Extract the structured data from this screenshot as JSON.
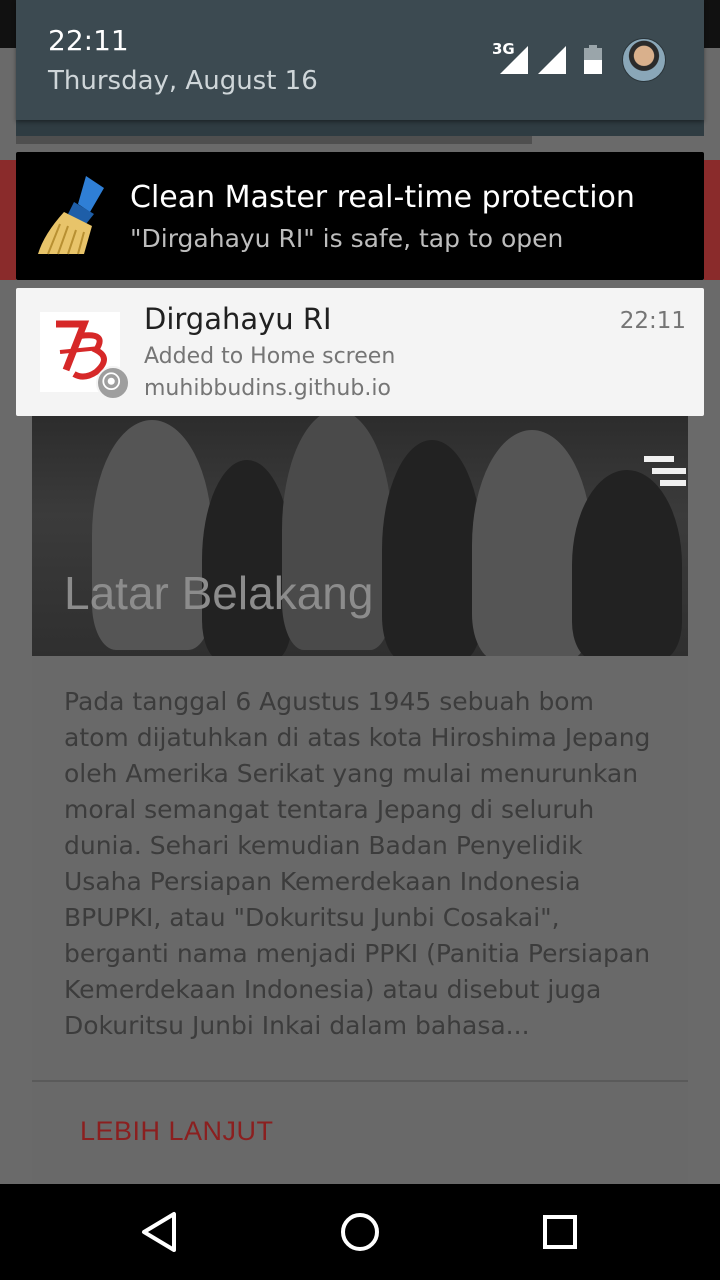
{
  "status": {
    "time": "22:11",
    "date": "Thursday, August 16",
    "network": "3G"
  },
  "notifications": [
    {
      "app": "Clean Master",
      "title": "Clean Master real-time protection",
      "text": "\"Dirgahayu RI\" is safe, tap to open"
    },
    {
      "title": "Dirgahayu RI",
      "time": "22:11",
      "line2": "Added to Home screen",
      "line3": "muhibbudins.github.io",
      "badge": "chrome-icon"
    }
  ],
  "page": {
    "hero_title": "Latar Belakang",
    "body": "Pada tanggal 6 Agustus 1945 sebuah bom atom dijatuhkan di atas kota Hiroshima Jepang oleh Amerika Serikat yang mulai menurunkan moral semangat tentara Jepang di seluruh dunia. Sehari kemudian Badan Penyelidik Usaha Persiapan Kemerdekaan Indonesia BPUPKI, atau \"Dokuritsu Junbi Cosakai\", berganti nama menjadi PPKI (Panitia Persiapan Kemerdekaan Indonesia) atau disebut juga Dokuritsu Junbi Inkai dalam bahasa...",
    "more_label": "LEBIH LANJUT"
  },
  "colors": {
    "shade": "#3c4a51",
    "accent_red": "#8b1f1f"
  },
  "icons": {
    "menu": "menu-icon",
    "back": "back-icon",
    "home": "home-icon",
    "recents": "recents-icon"
  }
}
